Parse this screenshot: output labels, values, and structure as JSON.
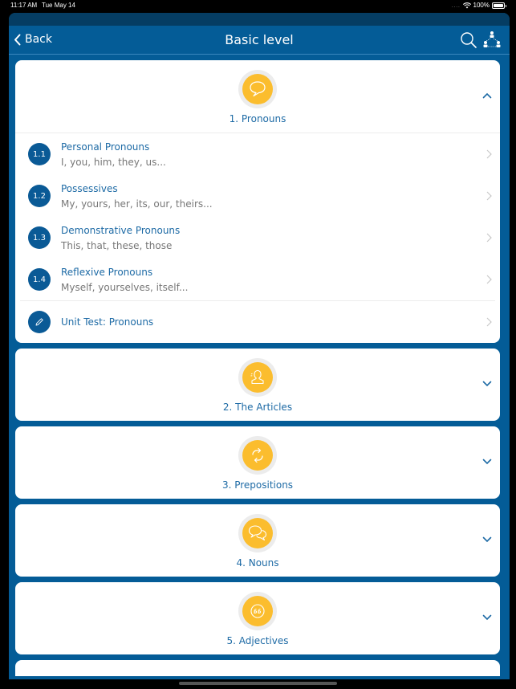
{
  "status_bar": {
    "time": "11:17 AM",
    "date": "Tue May 14",
    "battery": "100%"
  },
  "navbar": {
    "back_label": "Back",
    "title": "Basic level",
    "icons": [
      "search-icon",
      "hierarchy-icon"
    ]
  },
  "units": [
    {
      "title": "1. Pronouns",
      "icon": "speech-bubble-icon",
      "expanded": true,
      "lessons": [
        {
          "num": "1.1",
          "title": "Personal Pronouns",
          "desc": "I, you, him, they, us..."
        },
        {
          "num": "1.2",
          "title": "Possessives",
          "desc": "My, yours, her, its, our, theirs..."
        },
        {
          "num": "1.3",
          "title": "Demonstrative Pronouns",
          "desc": "This, that, these, those"
        },
        {
          "num": "1.4",
          "title": "Reflexive Pronouns",
          "desc": "Myself, yourselves, itself..."
        }
      ],
      "test": {
        "title": "Unit Test: Pronouns",
        "icon": "pencil-icon"
      }
    },
    {
      "title": "2. The Articles",
      "icon": "person-icon",
      "expanded": false
    },
    {
      "title": "3. Prepositions",
      "icon": "swap-arrows-icon",
      "expanded": false
    },
    {
      "title": "4. Nouns",
      "icon": "chat-bubbles-icon",
      "expanded": false
    },
    {
      "title": "5. Adjectives",
      "icon": "quote-icon",
      "expanded": false
    }
  ],
  "colors": {
    "navbar_bg": "#045c97",
    "accent_yellow": "#fbbd2e",
    "link_blue": "#1d6aa5",
    "number_badge": "#0a5a96"
  }
}
